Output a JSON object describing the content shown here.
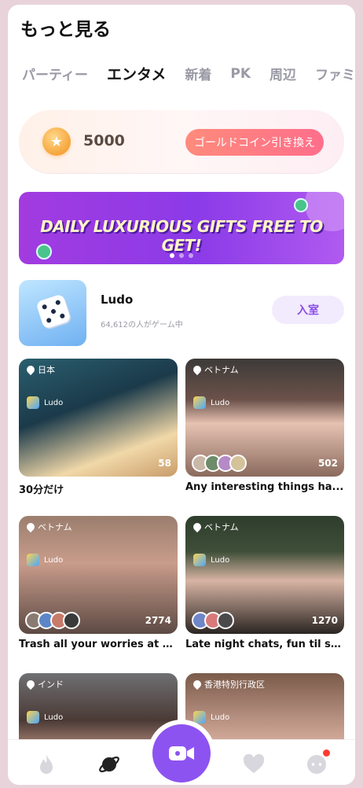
{
  "page": {
    "title": "もっと見る"
  },
  "tabs": [
    {
      "label": "パーティー"
    },
    {
      "label": "エンタメ"
    },
    {
      "label": "新着"
    },
    {
      "label": "PK"
    },
    {
      "label": "周辺"
    },
    {
      "label": "ファミ"
    }
  ],
  "coins": {
    "value": "5000",
    "exchange_label": "ゴールドコイン引き換え"
  },
  "banner": {
    "text": "DAILY LUXURIOUS GIFTS  FREE TO GET!"
  },
  "game": {
    "name": "Ludo",
    "players": "64,612の人がゲーム中",
    "enter_label": "入室"
  },
  "rooms": [
    {
      "location": "日本",
      "game": "Ludo",
      "count": "58",
      "caption": "30分だけ"
    },
    {
      "location": "ベトナム",
      "game": "Ludo",
      "count": "502",
      "caption": "Any interesting things ha..."
    },
    {
      "location": "ベトナム",
      "game": "Ludo",
      "count": "2774",
      "caption": "Trash all your worries at m..."
    },
    {
      "location": "ベトナム",
      "game": "Ludo",
      "count": "1270",
      "caption": "Late night chats, fun til su..."
    },
    {
      "location": "インド",
      "game": "Ludo"
    },
    {
      "location": "香港特別行政区",
      "game": "Ludo"
    }
  ],
  "bottom_nav": [
    {
      "icon": "flame-icon"
    },
    {
      "icon": "planet-icon"
    },
    {
      "icon": "live-camera-icon"
    },
    {
      "icon": "heart-icon"
    },
    {
      "icon": "chat-bubble-icon"
    }
  ],
  "colors": {
    "accent": "#8d53f0",
    "coin_button": "#ff7485"
  }
}
